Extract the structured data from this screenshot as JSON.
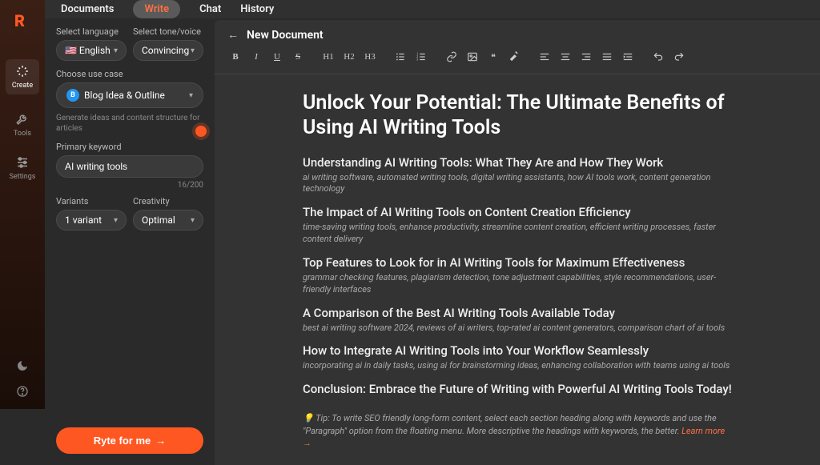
{
  "logo": "R",
  "leftnav": {
    "items": [
      {
        "label": "Create"
      },
      {
        "label": "Tools"
      },
      {
        "label": "Settings"
      }
    ]
  },
  "topbar": {
    "tabs": [
      "Documents",
      "Write",
      "Chat",
      "History"
    ]
  },
  "config": {
    "lang_label": "Select language",
    "lang_value": "🇺🇸 English",
    "tone_label": "Select tone/voice",
    "tone_value": "Convincing",
    "usecase_label": "Choose use case",
    "usecase_value": "Blog Idea & Outline",
    "usecase_icon_letter": "B",
    "usecase_help": "Generate ideas and content structure for articles",
    "keyword_label": "Primary keyword",
    "keyword_value": "AI writing tools",
    "keyword_counter": "16/200",
    "variants_label": "Variants",
    "variants_value": "1 variant",
    "creativity_label": "Creativity",
    "creativity_value": "Optimal",
    "cta_label": "Ryte for me"
  },
  "editor": {
    "back_arrow": "←",
    "doc_title": "New Document",
    "toolbar": {
      "h1": "H1",
      "h2": "H2",
      "h3": "H3"
    },
    "content": {
      "title": "Unlock Your Potential: The Ultimate Benefits of Using AI Writing Tools",
      "sections": [
        {
          "h": "Understanding AI Writing Tools: What They Are and How They Work",
          "kw": "ai writing software, automated writing tools, digital writing assistants, how AI tools work, content generation technology"
        },
        {
          "h": "The Impact of AI Writing Tools on Content Creation Efficiency",
          "kw": "time-saving writing tools, enhance productivity, streamline content creation, efficient writing processes, faster content delivery"
        },
        {
          "h": "Top Features to Look for in AI Writing Tools for Maximum Effectiveness",
          "kw": "grammar checking features, plagiarism detection, tone adjustment capabilities, style recommendations, user-friendly interfaces"
        },
        {
          "h": "A Comparison of the Best AI Writing Tools Available Today",
          "kw": "best ai writing software 2024, reviews of ai writers, top-rated ai content generators, comparison chart of ai tools"
        },
        {
          "h": "How to Integrate AI Writing Tools into Your Workflow Seamlessly",
          "kw": "incorporating ai in daily tasks, using ai for brainstorming ideas, enhancing collaboration with teams using ai tools"
        },
        {
          "h": "Conclusion: Embrace the Future of Writing with Powerful AI Writing Tools Today!",
          "kw": ""
        }
      ],
      "tip_prefix": "💡 Tip: To write SEO friendly long-form content, select each section heading along with keywords and use the \"Paragraph\" option from the floating menu. More descriptive the headings with keywords, the better. ",
      "tip_link": "Learn more →"
    }
  }
}
